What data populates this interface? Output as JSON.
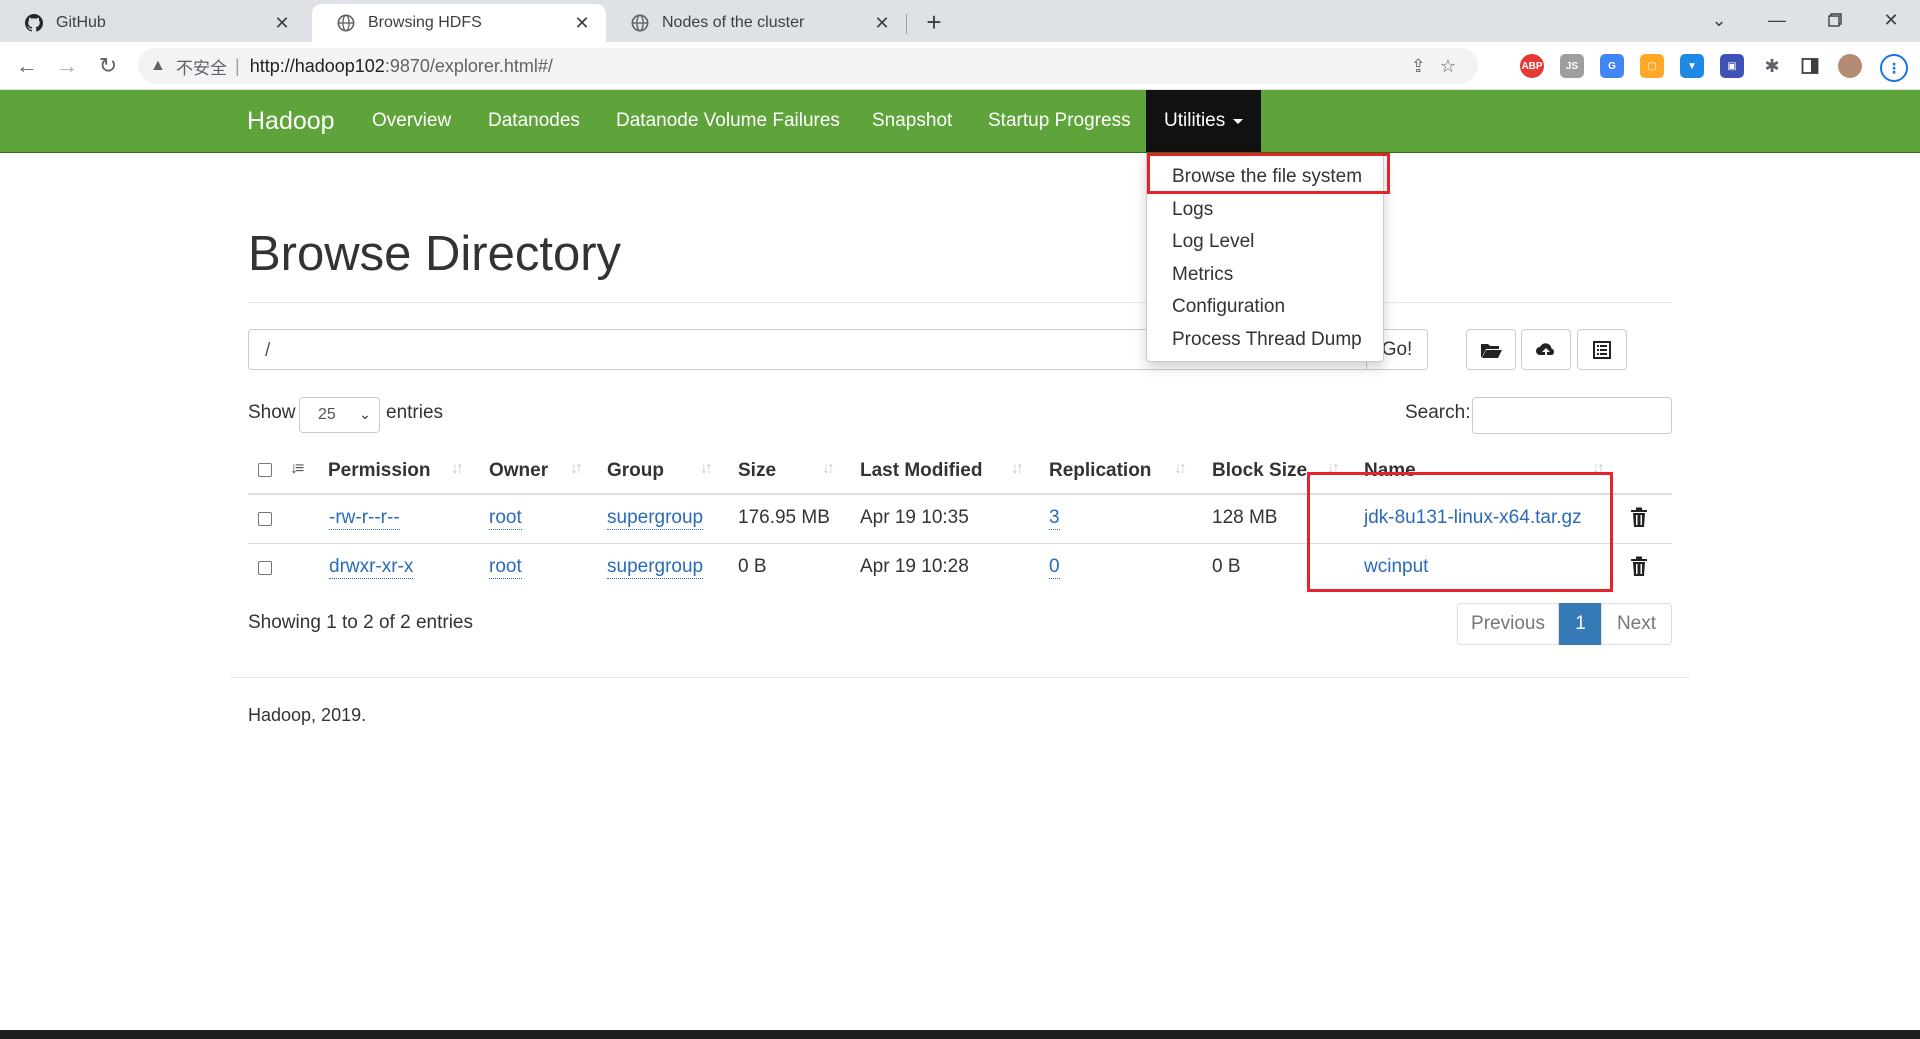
{
  "browser": {
    "tabs": [
      {
        "title": "GitHub",
        "icon": "github-icon"
      },
      {
        "title": "Browsing HDFS",
        "icon": "globe-icon"
      },
      {
        "title": "Nodes of the cluster",
        "icon": "globe-icon"
      }
    ],
    "address": {
      "insecure_label": "不安全",
      "url_host": "http://hadoop102",
      "url_rest": ":9870/explorer.html#/"
    }
  },
  "navbar": {
    "brand": "Hadoop",
    "items": [
      "Overview",
      "Datanodes",
      "Datanode Volume Failures",
      "Snapshot",
      "Startup Progress",
      "Utilities"
    ],
    "dropdown": [
      "Browse the file system",
      "Logs",
      "Log Level",
      "Metrics",
      "Configuration",
      "Process Thread Dump"
    ]
  },
  "page": {
    "title": "Browse Directory",
    "path_value": "/",
    "go_label": "Go!",
    "show_label": "Show",
    "entries_value": "25",
    "entries_label": "entries",
    "search_label": "Search:"
  },
  "table": {
    "columns": [
      "Permission",
      "Owner",
      "Group",
      "Size",
      "Last Modified",
      "Replication",
      "Block Size",
      "Name"
    ],
    "rows": [
      {
        "permission": "-rw-r--r--",
        "owner": "root",
        "group": "supergroup",
        "size": "176.95 MB",
        "modified": "Apr 19 10:35",
        "replication": "3",
        "block_size": "128 MB",
        "name": "jdk-8u131-linux-x64.tar.gz"
      },
      {
        "permission": "drwxr-xr-x",
        "owner": "root",
        "group": "supergroup",
        "size": "0 B",
        "modified": "Apr 19 10:28",
        "replication": "0",
        "block_size": "0 B",
        "name": "wcinput"
      }
    ],
    "info": "Showing 1 to 2 of 2 entries",
    "pagination": {
      "previous": "Previous",
      "current": "1",
      "next": "Next"
    }
  },
  "footer": "Hadoop, 2019.",
  "colors": {
    "navbar": "#5ea43a",
    "highlight": "#e8222a",
    "link": "#2a6ab7"
  }
}
